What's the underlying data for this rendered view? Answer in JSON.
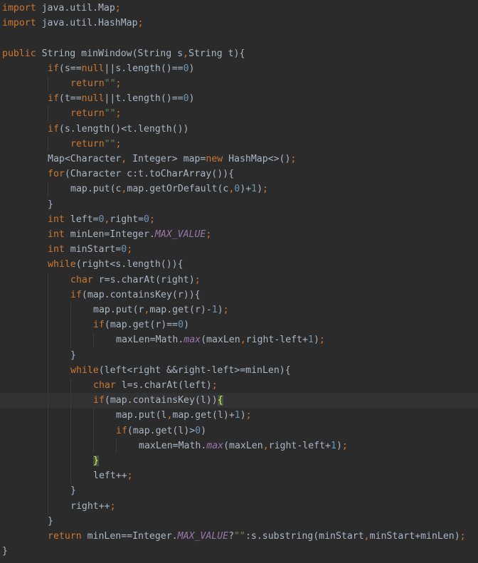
{
  "theme": {
    "background": "#2b2b2b",
    "current_line": "#323232",
    "text": "#a9b7c6",
    "keyword": "#cc7832",
    "number": "#6897bb",
    "string": "#6a8759",
    "brace_match": "#ffef28"
  },
  "editor": {
    "language": "Java",
    "lines": [
      {
        "indent": 0,
        "tokens": [
          {
            "t": "import",
            "k": "keyword"
          },
          {
            "t": " java.util.Map",
            "k": "text"
          },
          {
            "t": ";",
            "k": "punct"
          }
        ]
      },
      {
        "indent": 0,
        "tokens": [
          {
            "t": "import",
            "k": "keyword"
          },
          {
            "t": " java.util.HashMap",
            "k": "text"
          },
          {
            "t": ";",
            "k": "punct"
          }
        ]
      },
      {
        "indent": 0,
        "tokens": []
      },
      {
        "indent": 0,
        "tokens": [
          {
            "t": "public",
            "k": "keyword"
          },
          {
            "t": " String minWindow(String s",
            "k": "text"
          },
          {
            "t": ",",
            "k": "punct"
          },
          {
            "t": "String t){",
            "k": "text"
          }
        ]
      },
      {
        "indent": 2,
        "tokens": [
          {
            "t": "if",
            "k": "keyword"
          },
          {
            "t": "(s==",
            "k": "text"
          },
          {
            "t": "null",
            "k": "keyword"
          },
          {
            "t": "||s.length()==",
            "k": "text"
          },
          {
            "t": "0",
            "k": "number"
          },
          {
            "t": ")",
            "k": "text"
          }
        ]
      },
      {
        "indent": 3,
        "tokens": [
          {
            "t": "return",
            "k": "keyword"
          },
          {
            "t": "\"\"",
            "k": "string"
          },
          {
            "t": ";",
            "k": "punct"
          }
        ]
      },
      {
        "indent": 2,
        "tokens": [
          {
            "t": "if",
            "k": "keyword"
          },
          {
            "t": "(t==",
            "k": "text"
          },
          {
            "t": "null",
            "k": "keyword"
          },
          {
            "t": "||t.length()==",
            "k": "text"
          },
          {
            "t": "0",
            "k": "number"
          },
          {
            "t": ")",
            "k": "text"
          }
        ]
      },
      {
        "indent": 3,
        "tokens": [
          {
            "t": "return",
            "k": "keyword"
          },
          {
            "t": "\"\"",
            "k": "string"
          },
          {
            "t": ";",
            "k": "punct"
          }
        ]
      },
      {
        "indent": 2,
        "tokens": [
          {
            "t": "if",
            "k": "keyword"
          },
          {
            "t": "(s.length()<t.length())",
            "k": "text"
          }
        ]
      },
      {
        "indent": 3,
        "tokens": [
          {
            "t": "return",
            "k": "keyword"
          },
          {
            "t": "\"\"",
            "k": "string"
          },
          {
            "t": ";",
            "k": "punct"
          }
        ]
      },
      {
        "indent": 2,
        "tokens": [
          {
            "t": "Map<Character",
            "k": "text"
          },
          {
            "t": ",",
            "k": "punct"
          },
          {
            "t": " Integer> map=",
            "k": "text"
          },
          {
            "t": "new",
            "k": "keyword"
          },
          {
            "t": " HashMap<>()",
            "k": "text"
          },
          {
            "t": ";",
            "k": "punct"
          }
        ]
      },
      {
        "indent": 2,
        "tokens": [
          {
            "t": "for",
            "k": "keyword"
          },
          {
            "t": "(Character c:t.toCharArray()){",
            "k": "text"
          }
        ]
      },
      {
        "indent": 3,
        "tokens": [
          {
            "t": "map.put(c",
            "k": "text"
          },
          {
            "t": ",",
            "k": "punct"
          },
          {
            "t": "map.getOrDefault(c",
            "k": "text"
          },
          {
            "t": ",",
            "k": "punct"
          },
          {
            "t": "0",
            "k": "number"
          },
          {
            "t": ")+",
            "k": "text"
          },
          {
            "t": "1",
            "k": "number"
          },
          {
            "t": ")",
            "k": "text"
          },
          {
            "t": ";",
            "k": "punct"
          }
        ]
      },
      {
        "indent": 2,
        "tokens": [
          {
            "t": "}",
            "k": "text"
          }
        ]
      },
      {
        "indent": 2,
        "tokens": [
          {
            "t": "int",
            "k": "keyword"
          },
          {
            "t": " left=",
            "k": "text"
          },
          {
            "t": "0",
            "k": "number"
          },
          {
            "t": ",",
            "k": "punct"
          },
          {
            "t": "right=",
            "k": "text"
          },
          {
            "t": "0",
            "k": "number"
          },
          {
            "t": ";",
            "k": "punct"
          }
        ]
      },
      {
        "indent": 2,
        "tokens": [
          {
            "t": "int",
            "k": "keyword"
          },
          {
            "t": " minLen=Integer.",
            "k": "text"
          },
          {
            "t": "MAX_VALUE",
            "k": "constant"
          },
          {
            "t": ";",
            "k": "punct"
          }
        ]
      },
      {
        "indent": 2,
        "tokens": [
          {
            "t": "int",
            "k": "keyword"
          },
          {
            "t": " minStart=",
            "k": "text"
          },
          {
            "t": "0",
            "k": "number"
          },
          {
            "t": ";",
            "k": "punct"
          }
        ]
      },
      {
        "indent": 2,
        "tokens": [
          {
            "t": "while",
            "k": "keyword"
          },
          {
            "t": "(right<s.length()){",
            "k": "text"
          }
        ]
      },
      {
        "indent": 3,
        "tokens": [
          {
            "t": "char",
            "k": "keyword"
          },
          {
            "t": " r=s.charAt(right)",
            "k": "text"
          },
          {
            "t": ";",
            "k": "punct"
          }
        ]
      },
      {
        "indent": 3,
        "tokens": [
          {
            "t": "if",
            "k": "keyword"
          },
          {
            "t": "(map.containsKey(r)){",
            "k": "text"
          }
        ]
      },
      {
        "indent": 4,
        "tokens": [
          {
            "t": "map.put(r",
            "k": "text"
          },
          {
            "t": ",",
            "k": "punct"
          },
          {
            "t": "map.get(r)-",
            "k": "text"
          },
          {
            "t": "1",
            "k": "number"
          },
          {
            "t": ")",
            "k": "text"
          },
          {
            "t": ";",
            "k": "punct"
          }
        ]
      },
      {
        "indent": 4,
        "tokens": [
          {
            "t": "if",
            "k": "keyword"
          },
          {
            "t": "(map.get(r)==",
            "k": "text"
          },
          {
            "t": "0",
            "k": "number"
          },
          {
            "t": ")",
            "k": "text"
          }
        ]
      },
      {
        "indent": 5,
        "tokens": [
          {
            "t": "maxLen=Math.",
            "k": "text"
          },
          {
            "t": "max",
            "k": "constant"
          },
          {
            "t": "(maxLen",
            "k": "text"
          },
          {
            "t": ",",
            "k": "punct"
          },
          {
            "t": "right-left+",
            "k": "text"
          },
          {
            "t": "1",
            "k": "number"
          },
          {
            "t": ")",
            "k": "text"
          },
          {
            "t": ";",
            "k": "punct"
          }
        ]
      },
      {
        "indent": 3,
        "tokens": [
          {
            "t": "}",
            "k": "text"
          }
        ]
      },
      {
        "indent": 3,
        "tokens": [
          {
            "t": "while",
            "k": "keyword"
          },
          {
            "t": "(left<right &&right-left>=minLen){",
            "k": "text"
          }
        ]
      },
      {
        "indent": 4,
        "tokens": [
          {
            "t": "char",
            "k": "keyword"
          },
          {
            "t": " l=s.charAt(left)",
            "k": "text"
          },
          {
            "t": ";",
            "k": "punct"
          }
        ]
      },
      {
        "indent": 4,
        "current": true,
        "tokens": [
          {
            "t": "if",
            "k": "keyword"
          },
          {
            "t": "(map.containsKey(l))",
            "k": "text"
          },
          {
            "t": "{",
            "k": "brace-hl"
          }
        ]
      },
      {
        "indent": 5,
        "tokens": [
          {
            "t": "map.put(l",
            "k": "text"
          },
          {
            "t": ",",
            "k": "punct"
          },
          {
            "t": "map.get(l)+",
            "k": "text"
          },
          {
            "t": "1",
            "k": "number"
          },
          {
            "t": ")",
            "k": "text"
          },
          {
            "t": ";",
            "k": "punct"
          }
        ]
      },
      {
        "indent": 5,
        "tokens": [
          {
            "t": "if",
            "k": "keyword"
          },
          {
            "t": "(map.get(l)>",
            "k": "text"
          },
          {
            "t": "0",
            "k": "number"
          },
          {
            "t": ")",
            "k": "text"
          }
        ]
      },
      {
        "indent": 6,
        "tokens": [
          {
            "t": "maxLen=Math.",
            "k": "text"
          },
          {
            "t": "max",
            "k": "constant"
          },
          {
            "t": "(maxLen",
            "k": "text"
          },
          {
            "t": ",",
            "k": "punct"
          },
          {
            "t": "right-left+",
            "k": "text"
          },
          {
            "t": "1",
            "k": "number"
          },
          {
            "t": ")",
            "k": "text"
          },
          {
            "t": ";",
            "k": "punct"
          }
        ]
      },
      {
        "indent": 4,
        "tokens": [
          {
            "t": "}",
            "k": "brace-hl"
          }
        ]
      },
      {
        "indent": 4,
        "tokens": [
          {
            "t": "left++",
            "k": "text"
          },
          {
            "t": ";",
            "k": "punct"
          }
        ]
      },
      {
        "indent": 3,
        "tokens": [
          {
            "t": "}",
            "k": "text"
          }
        ]
      },
      {
        "indent": 3,
        "tokens": [
          {
            "t": "right++",
            "k": "text"
          },
          {
            "t": ";",
            "k": "punct"
          }
        ]
      },
      {
        "indent": 2,
        "tokens": [
          {
            "t": "}",
            "k": "text"
          }
        ]
      },
      {
        "indent": 2,
        "tokens": [
          {
            "t": "return",
            "k": "keyword"
          },
          {
            "t": " minLen==Integer.",
            "k": "text"
          },
          {
            "t": "MAX_VALUE",
            "k": "constant"
          },
          {
            "t": "?",
            "k": "text"
          },
          {
            "t": "\"\"",
            "k": "string"
          },
          {
            "t": ":s.substring(minStart",
            "k": "text"
          },
          {
            "t": ",",
            "k": "punct"
          },
          {
            "t": "minStart+minLen)",
            "k": "text"
          },
          {
            "t": ";",
            "k": "punct"
          }
        ]
      },
      {
        "indent": 0,
        "tokens": [
          {
            "t": "}",
            "k": "text"
          }
        ]
      }
    ]
  }
}
